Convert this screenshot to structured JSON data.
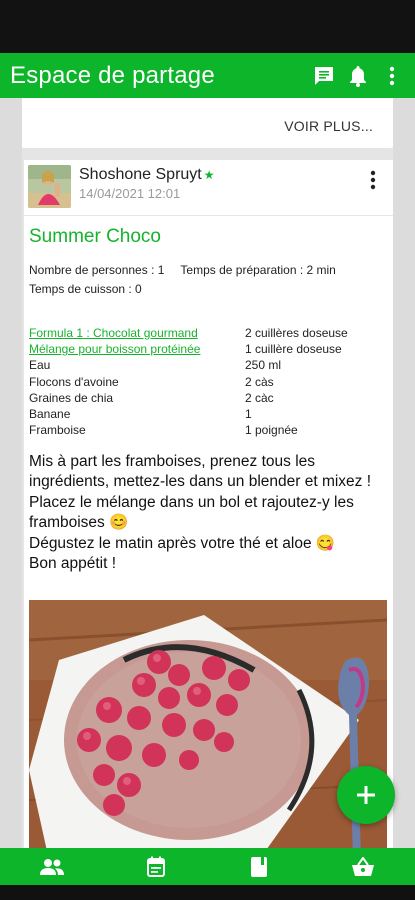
{
  "app_bar": {
    "title": "Espace de partage",
    "icons": [
      "chat-icon",
      "bell-icon",
      "more-vert-icon"
    ],
    "color": "#0db52b"
  },
  "previous_post": {
    "voir_plus": "VOIR PLUS..."
  },
  "post": {
    "author": "Shoshone Spruyt",
    "date": "14/04/2021 12:01",
    "recipe_title": "Summer Choco",
    "persons_label": "Nombre de personnes : 1",
    "prep_label": "Temps de préparation : 2 min",
    "cook_label": "Temps de cuisson : 0",
    "ingredients": [
      {
        "name": "Formula 1 : Chocolat gourmand",
        "qty": "2 cuillères doseuse",
        "link": true
      },
      {
        "name": "Mélange pour boisson protéinée",
        "qty": "1 cuillère doseuse",
        "link": true
      },
      {
        "name": "Eau",
        "qty": "250 ml",
        "link": false
      },
      {
        "name": "Flocons d'avoine",
        "qty": "2 càs",
        "link": false
      },
      {
        "name": "Graines de chia",
        "qty": "2 càc",
        "link": false
      },
      {
        "name": "Banane",
        "qty": "1",
        "link": false
      },
      {
        "name": "Framboise",
        "qty": "1 poignée",
        "link": false
      }
    ],
    "instructions": [
      "Mis à part les framboises, prenez tous les ingrédients, mettez-les dans un blender et mixez !",
      "Placez le mélange dans un bol et rajoutez-y les framboises 😊",
      "Dégustez le matin après votre thé et aloe 😋",
      "Bon appétit !"
    ]
  },
  "fab": {
    "icon": "plus-icon"
  },
  "bottom_nav": {
    "items": [
      "people-icon",
      "calendar-icon",
      "book-icon",
      "basket-icon"
    ]
  }
}
